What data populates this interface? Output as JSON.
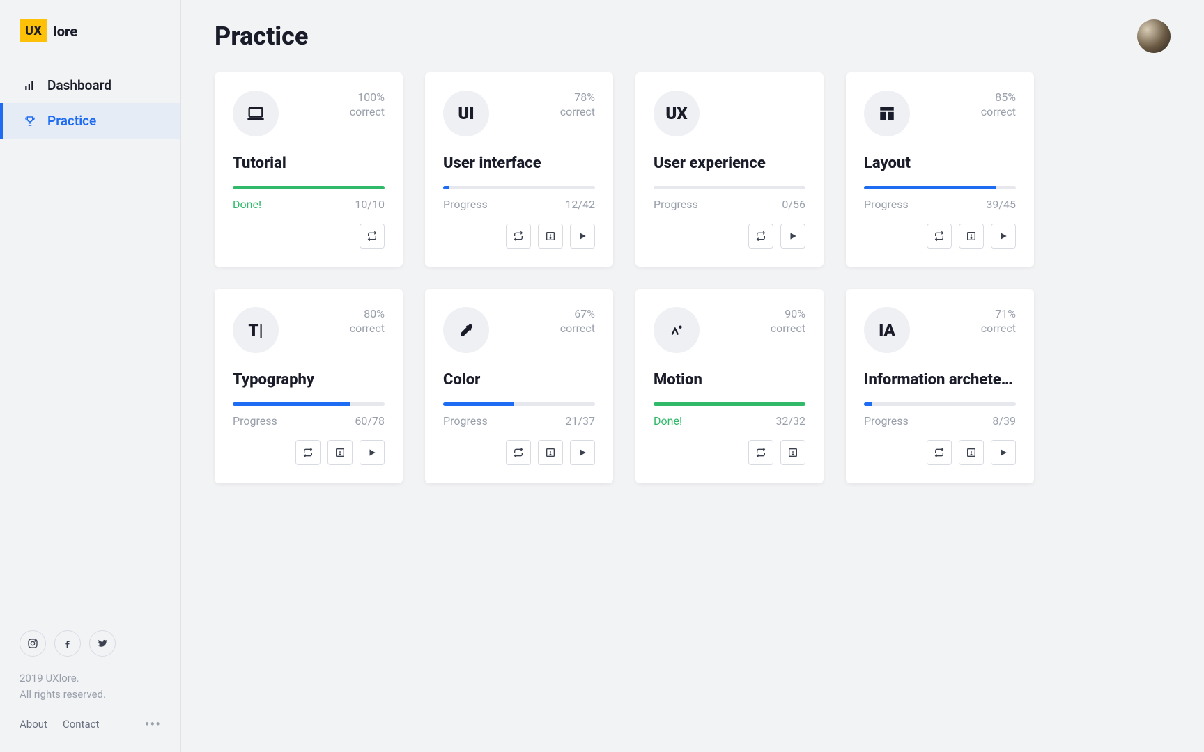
{
  "brand": {
    "badge": "UX",
    "name": "lore"
  },
  "sidebar": {
    "items": [
      {
        "label": "Dashboard",
        "icon": "bar-chart-icon",
        "active": false
      },
      {
        "label": "Practice",
        "icon": "trophy-icon",
        "active": true
      }
    ]
  },
  "footer": {
    "copyright_line1": "2019 UXlore.",
    "copyright_line2": "All rights reserved.",
    "links": {
      "about": "About",
      "contact": "Contact"
    }
  },
  "page": {
    "title": "Practice"
  },
  "labels": {
    "correct": "correct",
    "progress": "Progress",
    "done": "Done!"
  },
  "cards": [
    {
      "title": "Tutorial",
      "icon": "laptop-icon",
      "glyph": "",
      "correct_pct": "100%",
      "done": true,
      "progress_done": 10,
      "progress_total": 10,
      "fill_pct": 100,
      "actions": [
        "repeat"
      ]
    },
    {
      "title": "User interface",
      "icon": "text-icon",
      "glyph": "UI",
      "correct_pct": "78%",
      "done": false,
      "progress_done": 12,
      "progress_total": 42,
      "fill_pct": 4,
      "actions": [
        "repeat",
        "review",
        "play"
      ]
    },
    {
      "title": "User experience",
      "icon": "text-icon",
      "glyph": "UX",
      "correct_pct": "",
      "done": false,
      "progress_done": 0,
      "progress_total": 56,
      "fill_pct": 0,
      "actions": [
        "repeat",
        "play"
      ]
    },
    {
      "title": "Layout",
      "icon": "layout-icon",
      "glyph": "",
      "correct_pct": "85%",
      "done": false,
      "progress_done": 39,
      "progress_total": 45,
      "fill_pct": 87,
      "actions": [
        "repeat",
        "review",
        "play"
      ]
    },
    {
      "title": "Typography",
      "icon": "typography-icon",
      "glyph": "T|",
      "correct_pct": "80%",
      "done": false,
      "progress_done": 60,
      "progress_total": 78,
      "fill_pct": 77,
      "actions": [
        "repeat",
        "review",
        "play"
      ]
    },
    {
      "title": "Color",
      "icon": "eyedropper-icon",
      "glyph": "",
      "correct_pct": "67%",
      "done": false,
      "progress_done": 21,
      "progress_total": 37,
      "fill_pct": 47,
      "actions": [
        "repeat",
        "review",
        "play"
      ]
    },
    {
      "title": "Motion",
      "icon": "motion-icon",
      "glyph": "",
      "correct_pct": "90%",
      "done": true,
      "progress_done": 32,
      "progress_total": 32,
      "fill_pct": 100,
      "actions": [
        "repeat",
        "review"
      ]
    },
    {
      "title": "Information archetecture",
      "icon": "text-icon",
      "glyph": "IA",
      "correct_pct": "71%",
      "done": false,
      "progress_done": 8,
      "progress_total": 39,
      "fill_pct": 5,
      "actions": [
        "repeat",
        "review",
        "play"
      ]
    }
  ]
}
